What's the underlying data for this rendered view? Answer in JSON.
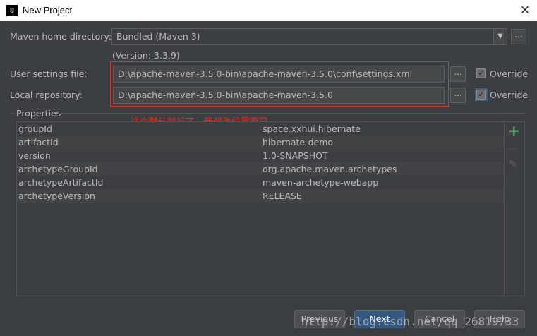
{
  "window": {
    "title": "New Project",
    "close_glyph": "✕",
    "app_icon_text": "IJ"
  },
  "form": {
    "maven_home_label": "Maven home directory:",
    "maven_home_value": "Bundled (Maven 3)",
    "version_text": "(Version: 3.3.9)",
    "user_settings_label": "User settings file:",
    "user_settings_value": "D:\\apache-maven-3.5.0-bin\\apache-maven-3.5.0\\conf\\settings.xml",
    "local_repo_label": "Local repository:",
    "local_repo_value": "D:\\apache-maven-3.5.0-bin\\apache-maven-3.5.0",
    "override_label": "Override",
    "browse_glyph": "...",
    "dropdown_glyph": "▼",
    "check_glyph": "✓"
  },
  "annotation": {
    "text": "这个默认就行了，我想改位置而已",
    "color": "#e0302c"
  },
  "properties": {
    "title": "Properties",
    "rows": [
      {
        "key": "groupId",
        "value": "space.xxhui.hibernate"
      },
      {
        "key": "artifactId",
        "value": "hibernate-demo"
      },
      {
        "key": "version",
        "value": "1.0-SNAPSHOT"
      },
      {
        "key": "archetypeGroupId",
        "value": "org.apache.maven.archetypes"
      },
      {
        "key": "archetypeArtifactId",
        "value": "maven-archetype-webapp"
      },
      {
        "key": "archetypeVersion",
        "value": "RELEASE"
      }
    ],
    "add_glyph": "+",
    "remove_glyph": "—",
    "edit_glyph": "✎"
  },
  "buttons": {
    "previous": "Previous",
    "next": "Next",
    "cancel": "Cancel",
    "help": "Help"
  },
  "watermark": "http://blog.csdn.net/qq_26819733",
  "colors": {
    "background": "#3c3f41",
    "accent": "#365880",
    "annotation": "#e0302c",
    "add": "#59a869"
  }
}
